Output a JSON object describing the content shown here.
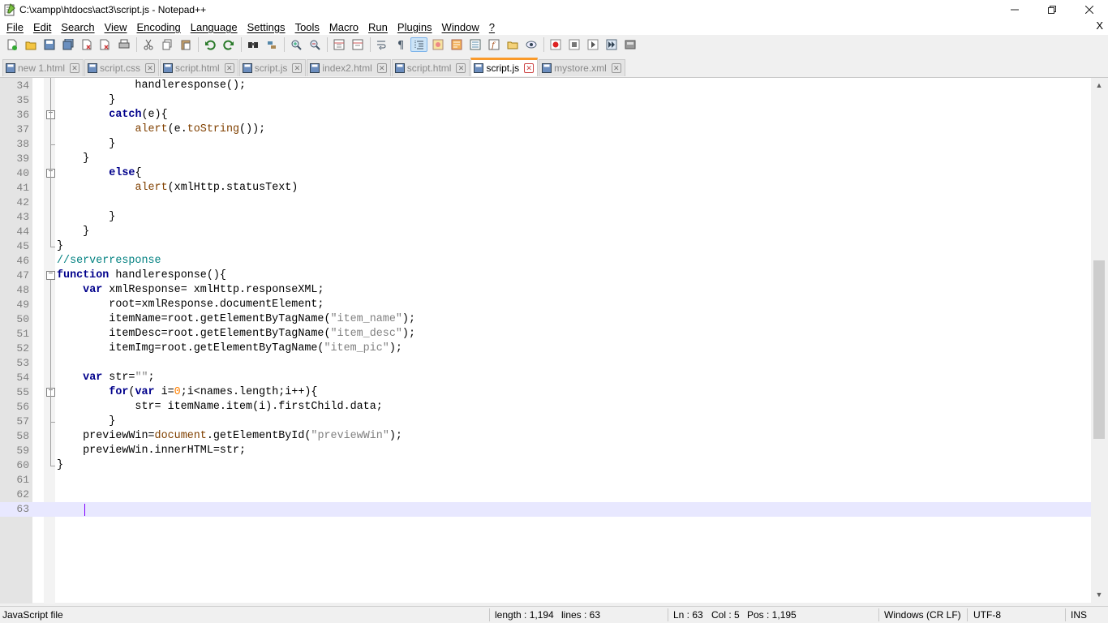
{
  "window": {
    "title": "C:\\xampp\\htdocs\\act3\\script.js - Notepad++",
    "minimize": "—",
    "maximize": "❐",
    "close": "✕"
  },
  "menu": {
    "items": [
      "File",
      "Edit",
      "Search",
      "View",
      "Encoding",
      "Language",
      "Settings",
      "Tools",
      "Macro",
      "Run",
      "Plugins",
      "Window",
      "?"
    ],
    "close_doc": "X"
  },
  "tabs": [
    {
      "label": "new 1.html",
      "active": false
    },
    {
      "label": "script.css",
      "active": false
    },
    {
      "label": "script.html",
      "active": false
    },
    {
      "label": "script.js",
      "active": false
    },
    {
      "label": "index2.html",
      "active": false
    },
    {
      "label": "script.html",
      "active": false
    },
    {
      "label": "script.js",
      "active": true
    },
    {
      "label": "mystore.xml",
      "active": false
    }
  ],
  "editor": {
    "current_line": 63,
    "lines": [
      {
        "n": "34",
        "code": "            handleresponse();"
      },
      {
        "n": "35",
        "code": "        }"
      },
      {
        "n": "36",
        "code": "        catch(e){"
      },
      {
        "n": "37",
        "code": "            alert(e.toString());"
      },
      {
        "n": "38",
        "code": "        }"
      },
      {
        "n": "39",
        "code": "    }"
      },
      {
        "n": "40",
        "code": "        else{"
      },
      {
        "n": "41",
        "code": "            alert(xmlHttp.statusText)"
      },
      {
        "n": "42",
        "code": ""
      },
      {
        "n": "43",
        "code": "        }"
      },
      {
        "n": "44",
        "code": "    }"
      },
      {
        "n": "45",
        "code": "}"
      },
      {
        "n": "46",
        "code": "//serverresponse"
      },
      {
        "n": "47",
        "code": "function handleresponse(){"
      },
      {
        "n": "48",
        "code": "    var xmlResponse= xmlHttp.responseXML;"
      },
      {
        "n": "49",
        "code": "        root=xmlResponse.documentElement;"
      },
      {
        "n": "50",
        "code": "        itemName=root.getElementByTagName(\"item_name\");"
      },
      {
        "n": "51",
        "code": "        itemDesc=root.getElementByTagName(\"item_desc\");"
      },
      {
        "n": "52",
        "code": "        itemImg=root.getElementByTagName(\"item_pic\");"
      },
      {
        "n": "53",
        "code": ""
      },
      {
        "n": "54",
        "code": "    var str=\"\";"
      },
      {
        "n": "55",
        "code": "        for(var i=0;i<names.length;i++){"
      },
      {
        "n": "56",
        "code": "            str= itemName.item(i).firstChild.data;"
      },
      {
        "n": "57",
        "code": "        }"
      },
      {
        "n": "58",
        "code": "    previewWin=document.getElementById(\"previewWin\");"
      },
      {
        "n": "59",
        "code": "    previewWin.innerHTML=str;"
      },
      {
        "n": "60",
        "code": "}"
      },
      {
        "n": "61",
        "code": ""
      },
      {
        "n": "62",
        "code": ""
      },
      {
        "n": "63",
        "code": ""
      }
    ]
  },
  "status": {
    "filetype": "JavaScript file",
    "length": "length : 1,194",
    "lines": "lines : 63",
    "ln": "Ln : 63",
    "col": "Col : 5",
    "pos": "Pos : 1,195",
    "eol": "Windows (CR LF)",
    "encoding": "UTF-8",
    "mode": "INS"
  }
}
